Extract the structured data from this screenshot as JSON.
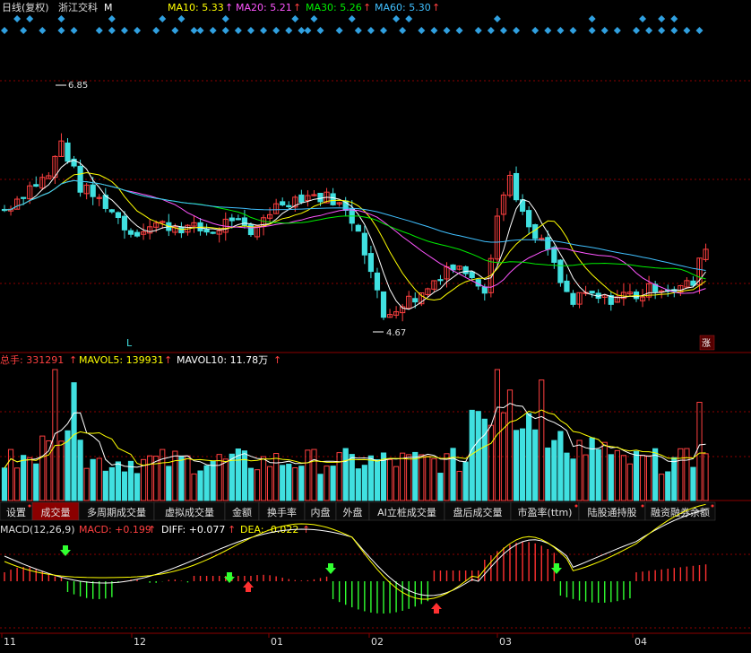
{
  "header": {
    "period": "日线(复权)",
    "stock_name": "浙江交科",
    "ma5_label": "M",
    "ma10": {
      "label": "MA10: 5.33",
      "color": "#ffff00"
    },
    "ma20": {
      "label": "MA20: 5.21",
      "color": "#ff55ff"
    },
    "ma30": {
      "label": "MA30: 5.26",
      "color": "#00ee00"
    },
    "ma60": {
      "label": "MA60: 5.30",
      "color": "#40c0ff"
    }
  },
  "price_annotations": {
    "high": "6.85",
    "low": "4.67",
    "marker_L": "L",
    "marker_zhang": "涨"
  },
  "volume_header": {
    "total_label": "总手: 331291",
    "mavol5": "MAVOL5: 139931",
    "mavol10": "MAVOL10: 11.78万"
  },
  "tabs": [
    {
      "label": "设置",
      "active": false,
      "dot": true
    },
    {
      "label": "成交量",
      "active": true,
      "dot": false
    },
    {
      "label": "多周期成交量",
      "active": false,
      "dot": false
    },
    {
      "label": "虚拟成交量",
      "active": false,
      "dot": false
    },
    {
      "label": "金额",
      "active": false,
      "dot": false
    },
    {
      "label": "换手率",
      "active": false,
      "dot": false
    },
    {
      "label": "内盘",
      "active": false,
      "dot": false
    },
    {
      "label": "外盘",
      "active": false,
      "dot": false
    },
    {
      "label": "AI立桩成交量",
      "active": false,
      "dot": false
    },
    {
      "label": "盘后成交量",
      "active": false,
      "dot": false
    },
    {
      "label": "市盈率(ttm)",
      "active": false,
      "dot": true
    },
    {
      "label": "陆股通持股",
      "active": false,
      "dot": true
    },
    {
      "label": "融资融券余额",
      "active": false,
      "dot": true
    }
  ],
  "macd_header": {
    "name": "MACD(12,26,9)",
    "macd": "MACD: +0.199",
    "diff": "DIFF: +0.077",
    "dea": "DEA: -0.022"
  },
  "x_axis": [
    "11",
    "12",
    "01",
    "02",
    "03",
    "04"
  ],
  "colors": {
    "up": "#ff4040",
    "down": "#40e0e0",
    "grid": "#8b0000",
    "ma5": "#ffffff",
    "ma10": "#ffff00",
    "ma20": "#ff55ff",
    "ma30": "#00ee00",
    "ma60": "#40c0ff",
    "macd_up": "#ff3030",
    "macd_down": "#30ff30"
  },
  "chart_data": {
    "type": "candlestick",
    "price_high": 6.85,
    "price_low": 4.67,
    "ma_latest": {
      "MA10": 5.33,
      "MA20": 5.21,
      "MA30": 5.26,
      "MA60": 5.3
    },
    "volume_latest": {
      "total": 331291,
      "MAVOL5": 139931,
      "MAVOL10": 117800
    },
    "macd_latest": {
      "MACD": 0.199,
      "DIFF": 0.077,
      "DEA": -0.022
    },
    "months": [
      "11",
      "12",
      "01",
      "02",
      "03",
      "04"
    ]
  }
}
